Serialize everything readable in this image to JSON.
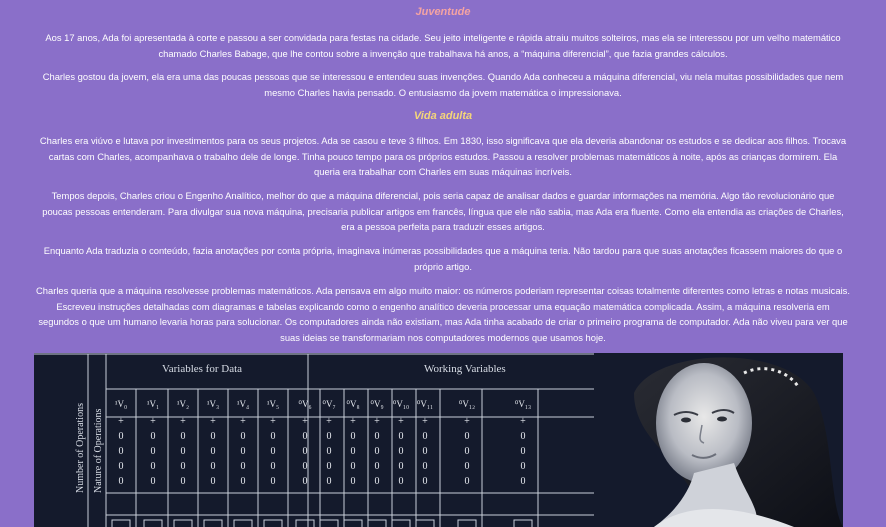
{
  "sections": {
    "juventude": {
      "heading": "Juventude",
      "paragraphs": [
        "Aos 17 anos, Ada foi apresentada à corte e passou a ser convidada para festas na cidade. Seu jeito inteligente e rápida atraiu muitos solteiros, mas ela se interessou por um velho matemático chamado Charles Babage, que lhe contou sobre a invenção que trabalhava há anos, a “máquina diferencial”, que fazia grandes cálculos.",
        "Charles gostou da jovem, ela era uma das poucas pessoas que se interessou e entendeu suas invenções. Quando Ada conheceu a máquina diferencial, viu nela muitas possibilidades que nem mesmo Charles havia pensado. O entusiasmo da jovem matemática o impressionava."
      ]
    },
    "vida_adulta": {
      "heading": "Vida adulta",
      "paragraphs": [
        "Charles era viúvo e lutava por investimentos para os seus projetos. Ada se casou e teve 3 filhos. Em 1830, isso significava que ela deveria abandonar os estudos e se dedicar aos filhos. Trocava cartas com Charles, acompanhava o trabalho dele de longe. Tinha pouco tempo para os próprios estudos. Passou a resolver problemas matemáticos à noite, após as crianças dormirem. Ela queria era trabalhar com Charles em suas máquinas incríveis.",
        "Tempos depois, Charles criou o Engenho Analítico, melhor do que a máquina diferencial, pois seria capaz de analisar dados e guardar informações na memória. Algo tão revolucionário que poucas pessoas entenderam. Para divulgar sua nova máquina, precisaria publicar artigos em francês, língua que ele não sabia, mas Ada era fluente. Como ela entendia as criações de Charles, era a pessoa perfeita para traduzir esses artigos.",
        "Enquanto Ada traduzia o conteúdo, fazia anotações por conta própria, imaginava inúmeras possibilidades que a máquina teria. Não tardou para que suas anotações ficassem maiores do que o próprio artigo.",
        "Charles queria que a máquina resolvesse problemas matemáticos. Ada pensava em algo muito maior: os números poderiam representar coisas totalmente diferentes como letras e notas musicais. Escreveu instruções detalhadas com diagramas e tabelas explicando como o engenho analítico deveria processar uma equação matemática complicada. Assim, a máquina resolveria em segundos o que um humano levaria horas para solucionar. Os computadores ainda não existiam, mas Ada tinha acabado de criar o primeiro programa de computador. Ada não viveu para ver que suas ideias se transformariam nos computadores modernos que usamos hoje."
      ]
    }
  },
  "hero_image": {
    "table": {
      "header_left_1": "Number of Operations",
      "header_left_2": "Nature of Operations",
      "group_1": "Variables for Data",
      "group_2": "Working Variables",
      "columns": [
        "¹V₀",
        "¹V₁",
        "¹V₂",
        "¹V₃",
        "¹V₄",
        "¹V₅",
        "⁰V₆",
        "⁰V₇",
        "⁰V₈",
        "⁰V₉",
        "⁰V₁₀",
        "⁰V₁₁",
        "⁰V₁₂",
        "⁰V₁₃"
      ],
      "row_plus": "+",
      "row_zero": "0",
      "side_zero": "0"
    },
    "colors": {
      "background": "#8a6fc9",
      "heading_juventude": "#f4a3a3",
      "heading_vida_adulta": "#f4d57a",
      "image_dark": "#141a2c"
    }
  }
}
